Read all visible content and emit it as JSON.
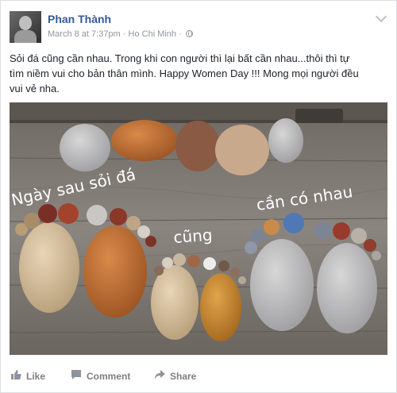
{
  "post": {
    "author": "Phan Thành",
    "timestamp": "March 8 at 7:37pm",
    "location": "Ho Chi Minh",
    "separator": "·",
    "text_line1": "Sỏi đá cũng cần nhau. Trong khi con người thì lại bất cần nhau...thôi thì tự",
    "text_line2": "tìm niềm vui cho bản thân mình. Happy Women Day !!! Mong mọi người đều",
    "text_line3": "vui vẻ nha."
  },
  "photo": {
    "caption1": "Ngày sau sỏi đá",
    "caption2": "cũng",
    "caption3": "cần có nhau"
  },
  "actions": {
    "like": "Like",
    "comment": "Comment",
    "share": "Share"
  },
  "icons": {
    "globe": "globe-icon",
    "chevron": "chevron-down-icon",
    "like": "thumbs-up-icon",
    "comment": "comment-bubble-icon",
    "share": "share-arrow-icon"
  },
  "colors": {
    "name": "#365899",
    "meta": "#90949c",
    "action": "#7f7f7f"
  }
}
